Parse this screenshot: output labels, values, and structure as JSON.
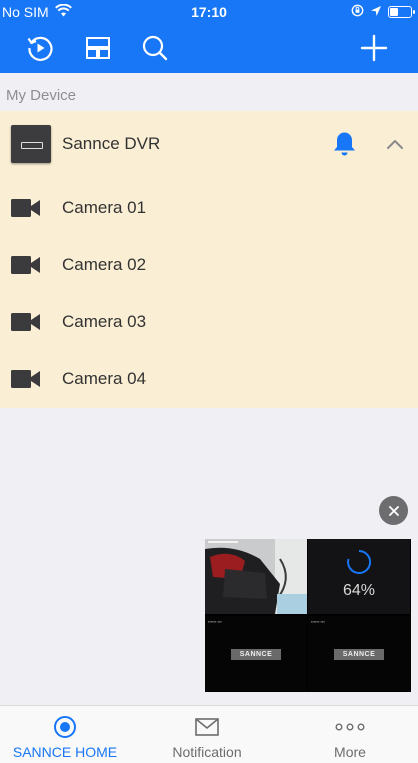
{
  "status_bar": {
    "carrier": "No SIM",
    "time": "17:10"
  },
  "toolbar": {
    "icons": [
      "playback-icon",
      "layout-icon",
      "search-icon",
      "add-icon"
    ],
    "accent": "#1777f7"
  },
  "section_label": "My Device",
  "device": {
    "name": "Sannce DVR",
    "cameras": [
      {
        "label": "Camera 01"
      },
      {
        "label": "Camera 02"
      },
      {
        "label": "Camera 03"
      },
      {
        "label": "Camera 04"
      }
    ]
  },
  "preview": {
    "progress_text": "64%",
    "brand_label": "SANNCE"
  },
  "tabs": [
    {
      "label": "SANNCE HOME",
      "active": true
    },
    {
      "label": "Notification",
      "active": false
    },
    {
      "label": "More",
      "active": false
    }
  ]
}
